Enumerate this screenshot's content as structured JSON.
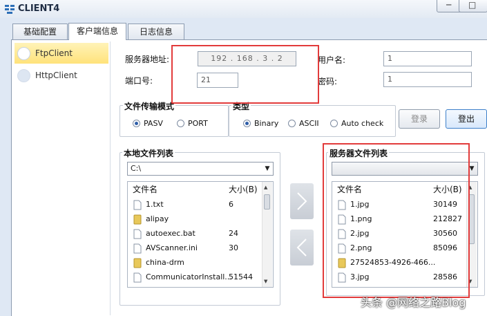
{
  "window": {
    "title": "CLIENT4"
  },
  "tabs": [
    {
      "label": "基础配置"
    },
    {
      "label": "客户端信息"
    },
    {
      "label": "日志信息"
    }
  ],
  "sidebar": {
    "items": [
      {
        "label": "FtpClient"
      },
      {
        "label": "HttpClient"
      }
    ]
  },
  "server": {
    "address_label": "服务器地址:",
    "address_value": "192 . 168 . 3 . 2",
    "port_label": "端口号:",
    "port_value": "21",
    "user_label": "用户名:",
    "user_value": "1",
    "password_label": "密码:",
    "password_value": "1"
  },
  "transfer_mode": {
    "title": "文件传输模式",
    "options": [
      {
        "label": "PASV",
        "selected": true
      },
      {
        "label": "PORT",
        "selected": false
      }
    ]
  },
  "type_group": {
    "title": "类型",
    "options": [
      {
        "label": "Binary",
        "selected": true
      },
      {
        "label": "ASCII",
        "selected": false
      },
      {
        "label": "Auto check",
        "selected": false
      }
    ]
  },
  "buttons": {
    "login": "登录",
    "logout": "登出"
  },
  "local_list": {
    "title": "本地文件列表",
    "drive": "C:\\",
    "col_name": "文件名",
    "col_size": "大小(B)",
    "files": [
      {
        "name": "1.txt",
        "size": "6",
        "kind": "file"
      },
      {
        "name": "alipay",
        "size": "",
        "kind": "folder"
      },
      {
        "name": "autoexec.bat",
        "size": "24",
        "kind": "file"
      },
      {
        "name": "AVScanner.ini",
        "size": "30",
        "kind": "file"
      },
      {
        "name": "china-drm",
        "size": "",
        "kind": "folder"
      },
      {
        "name": "CommunicatorInstall...",
        "size": "51544",
        "kind": "file"
      }
    ]
  },
  "server_list": {
    "title": "服务器文件列表",
    "drive": "",
    "col_name": "文件名",
    "col_size": "大小(B)",
    "files": [
      {
        "name": "1.jpg",
        "size": "30149",
        "kind": "file"
      },
      {
        "name": "1.png",
        "size": "212827",
        "kind": "file"
      },
      {
        "name": "2.jpg",
        "size": "30560",
        "kind": "file"
      },
      {
        "name": "2.png",
        "size": "85096",
        "kind": "file"
      },
      {
        "name": "27524853-4926-466...",
        "size": "",
        "kind": "folder"
      },
      {
        "name": "3.jpg",
        "size": "28586",
        "kind": "file"
      }
    ]
  },
  "watermark": "头条 @网络之路Blog",
  "colors": {
    "highlight_box": "#e23b3b",
    "active_nav": "#ffe27a"
  }
}
